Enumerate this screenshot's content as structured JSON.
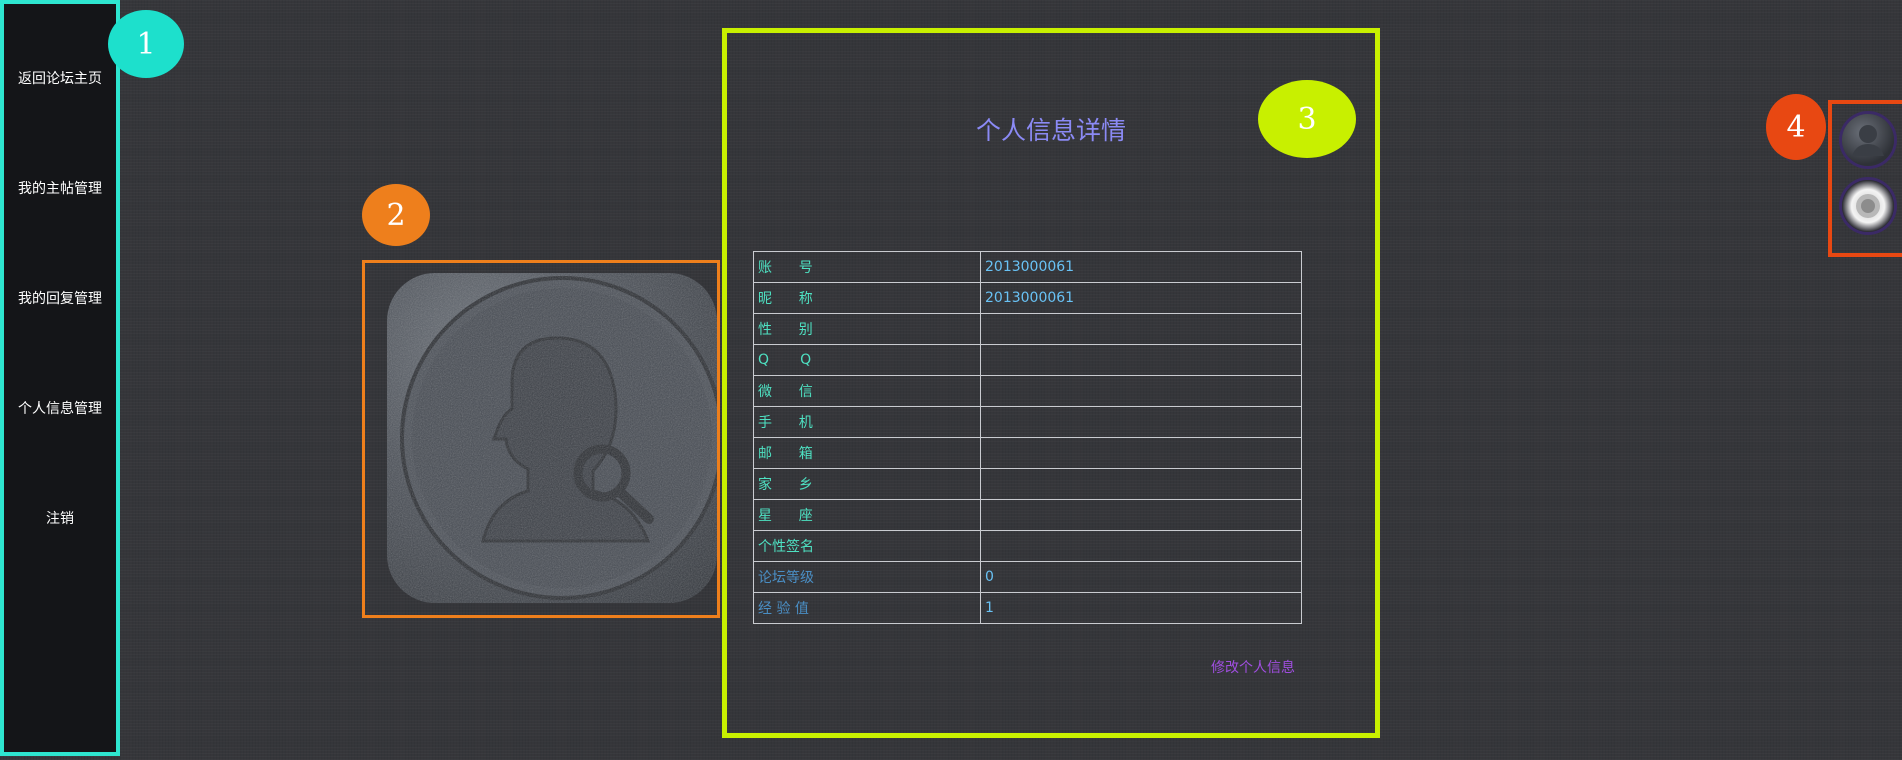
{
  "sidebar": {
    "items": [
      {
        "label": "返回论坛主页"
      },
      {
        "label": "我的主帖管理"
      },
      {
        "label": "我的回复管理"
      },
      {
        "label": "个人信息管理"
      },
      {
        "label": "注销"
      }
    ]
  },
  "badges": {
    "b1": "1",
    "b2": "2",
    "b3": "3",
    "b4": "4"
  },
  "colors": {
    "badge1": "#1de0cc",
    "badge2": "#ee7f1c",
    "badge3": "#c8f000",
    "badge4": "#e84812"
  },
  "info": {
    "title": "个人信息详情",
    "rows": [
      {
        "label": "账      号",
        "value": "2013000061"
      },
      {
        "label": "昵      称",
        "value": "2013000061"
      },
      {
        "label": "性      别",
        "value": ""
      },
      {
        "label": "Q       Q",
        "value": ""
      },
      {
        "label": "微      信",
        "value": ""
      },
      {
        "label": "手      机",
        "value": ""
      },
      {
        "label": "邮      箱",
        "value": ""
      },
      {
        "label": "家      乡",
        "value": ""
      },
      {
        "label": "星      座",
        "value": ""
      },
      {
        "label": "个性签名",
        "value": ""
      },
      {
        "label": "论坛等级",
        "value": "0"
      },
      {
        "label": "经 验 值",
        "value": "1"
      }
    ],
    "edit_link": "修改个人信息"
  }
}
